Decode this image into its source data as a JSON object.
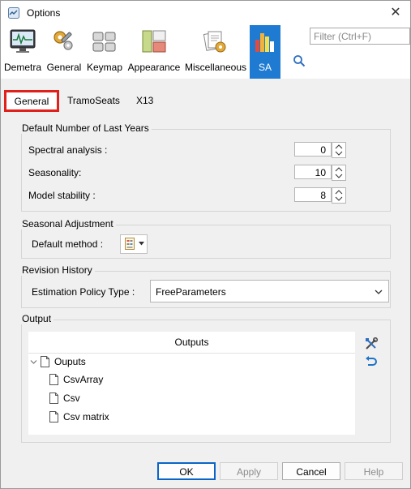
{
  "window": {
    "title": "Options",
    "close_glyph": "✕"
  },
  "toolbar": {
    "items": [
      {
        "label": "Demetra",
        "icon": "monitor-chart-icon"
      },
      {
        "label": "General",
        "icon": "gears-wrench-icon"
      },
      {
        "label": "Keymap",
        "icon": "keyboard-icon"
      },
      {
        "label": "Appearance",
        "icon": "color-panels-icon"
      },
      {
        "label": "Miscellaneous",
        "icon": "documents-gear-icon"
      },
      {
        "label": "SA",
        "icon": "bar-chart-icon",
        "selected": true
      }
    ]
  },
  "filter": {
    "placeholder": "Filter (Ctrl+F)",
    "value": ""
  },
  "tabs": [
    {
      "label": "General",
      "active": true
    },
    {
      "label": "TramoSeats"
    },
    {
      "label": "X13"
    }
  ],
  "default_years": {
    "title": "Default Number of Last Years",
    "rows": [
      {
        "label": "Spectral analysis :",
        "value": "0"
      },
      {
        "label": "Seasonality:",
        "value": "10"
      },
      {
        "label": "Model stability :",
        "value": "8"
      }
    ]
  },
  "seasonal_adjustment": {
    "title": "Seasonal Adjustment",
    "method_label": "Default method :"
  },
  "revision_history": {
    "title": "Revision History",
    "policy_label": "Estimation Policy Type :",
    "policy_value": "FreeParameters"
  },
  "output": {
    "title": "Output",
    "header": "Outputs",
    "root": "Ouputs",
    "children": [
      "CsvArray",
      "Csv",
      "Csv matrix"
    ]
  },
  "buttons": {
    "ok": "OK",
    "apply": "Apply",
    "cancel": "Cancel",
    "help": "Help"
  },
  "colors": {
    "selected_tool": "#1e7bd1",
    "tab_highlight": "#e0201a",
    "default_button_border": "#0a64c8"
  }
}
